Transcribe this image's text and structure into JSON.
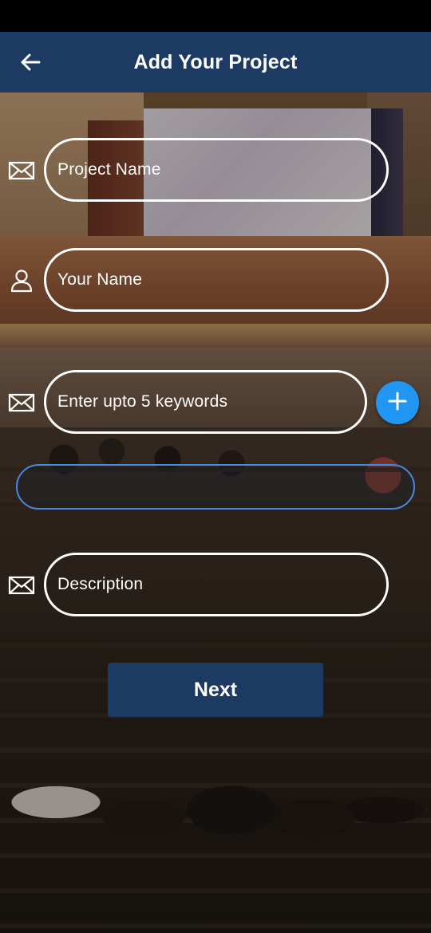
{
  "header": {
    "title": "Add Your Project",
    "back_icon": "arrow-left-icon",
    "background_color": "#1d3a63"
  },
  "form": {
    "project_name": {
      "placeholder": "Project Name",
      "icon": "mail-icon"
    },
    "your_name": {
      "placeholder": "Your Name",
      "icon": "person-icon"
    },
    "keywords": {
      "placeholder": "Enter upto 5 keywords",
      "icon": "mail-icon",
      "add_icon": "plus-icon"
    },
    "keywords_list": {
      "value": ""
    },
    "description": {
      "placeholder": "Description",
      "icon": "mail-icon"
    }
  },
  "actions": {
    "next_label": "Next"
  },
  "colors": {
    "accent": "#2196f3",
    "primary": "#1d3a63",
    "field_border": "#ffffff"
  }
}
